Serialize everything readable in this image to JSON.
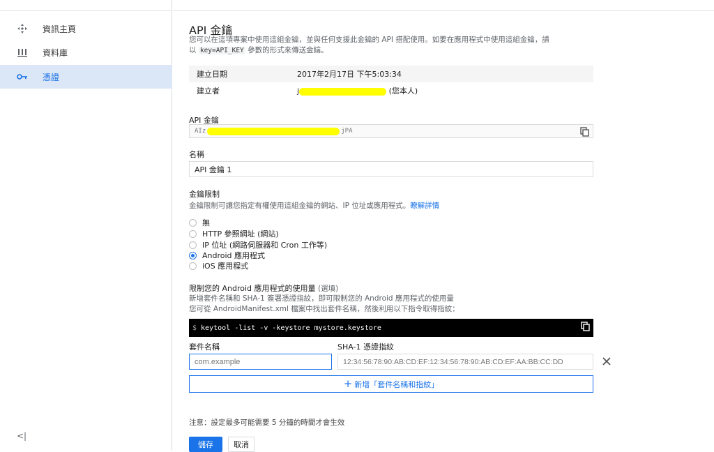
{
  "sidebar": {
    "items": [
      {
        "label": "資訊主頁",
        "icon": "dashboard-icon"
      },
      {
        "label": "資料庫",
        "icon": "library-icon"
      },
      {
        "label": "憑證",
        "icon": "key-icon",
        "active": true
      }
    ],
    "collapse_label": "<|"
  },
  "page": {
    "title": "API 金鑰",
    "desc_line1": "您可以在這項專案中使用這組金鑰，並與任何支援此金鑰的 API 搭配使用。如要在應用程式中使用這組金鑰，請",
    "desc_line2_pre": "以",
    "desc_code": "key=API_KEY",
    "desc_line2_post": "參數的形式來傳送金鑰。"
  },
  "info": {
    "created_label": "建立日期",
    "created_value": "2017年2月17日 下午5:03:34",
    "creator_label": "建立者",
    "creator_prefix": "j",
    "creator_suffix": "(您本人)"
  },
  "api_key": {
    "label": "API 金鑰",
    "prefix": "AIz",
    "suffix": "jPA"
  },
  "name": {
    "label": "名稱",
    "value": "API 金鑰 1"
  },
  "restrictions": {
    "label": "金鑰限制",
    "desc": "金鑰限制可讓您指定有權使用這組金鑰的網站、IP 位址或應用程式。",
    "learn_more": "瞭解詳情",
    "options": [
      {
        "label": "無",
        "selected": false
      },
      {
        "label": "HTTP 參照網址 (網站)",
        "selected": false
      },
      {
        "label": "IP 位址 (網路伺服器和 Cron 工作等)",
        "selected": false
      },
      {
        "label": "Android 應用程式",
        "selected": true
      },
      {
        "label": "iOS 應用程式",
        "selected": false
      }
    ]
  },
  "android": {
    "title": "限制您的 Android 應用程式的使用量",
    "optional": "(選填)",
    "desc1": "新增套件名稱和 SHA-1 簽署憑證指紋，即可限制您的 Android 應用程式的使用量",
    "desc2": "您可從 AndroidManifest.xml 檔案中找出套件名稱，然後利用以下指令取得指紋：",
    "command_prompt": "$",
    "command": "keytool -list -v -keystore mystore.keystore",
    "package_label": "套件名稱",
    "package_placeholder": "com.example",
    "sha_label": "SHA-1 憑證指紋",
    "sha_placeholder": "12:34:56:78:90:AB:CD:EF:12:34:56:78:90:AB:CD:EF:AA:BB:CC:DD",
    "add_button": "新增「套件名稱和指紋」"
  },
  "note": "注意：設定最多可能需要 5 分鐘的時間才會生效",
  "buttons": {
    "save": "儲存",
    "cancel": "取消"
  },
  "colors": {
    "accent": "#1a73e8",
    "redaction": "#ffff00"
  }
}
